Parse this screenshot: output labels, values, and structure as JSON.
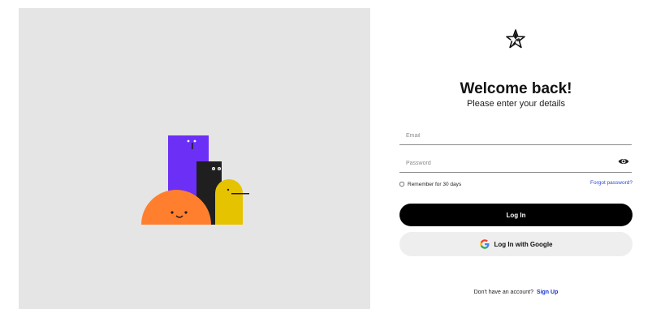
{
  "app": {
    "brand_icon": "star-logo-icon"
  },
  "header": {
    "title": "Welcome back!",
    "subtitle": "Please enter your details"
  },
  "form": {
    "email": {
      "placeholder": "Email",
      "value": ""
    },
    "password": {
      "placeholder": "Password",
      "value": "",
      "toggle_icon": "eye-icon"
    },
    "remember_label": "Remember for 30 days",
    "remember_checked": false,
    "forgot_label": "Forgot password?",
    "login_label": "Log In",
    "google_label": "Log In with Google",
    "google_icon": "google-icon"
  },
  "footer": {
    "prompt": "Don't have an account?",
    "signup_label": "Sign Up"
  },
  "colors": {
    "art_background": "#e5e5e5",
    "primary_button": "#000000",
    "secondary_button": "#eeeeee",
    "link": "#1b33d1",
    "purple": "#6c2ff6",
    "black": "#1f1f1f",
    "yellow": "#e6c300",
    "orange": "#ff7f2e"
  }
}
